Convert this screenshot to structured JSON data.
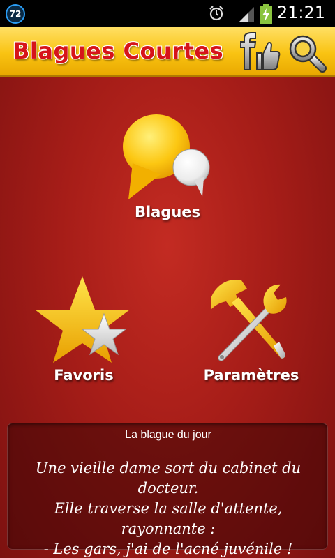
{
  "status_bar": {
    "notification_count": "72",
    "time": "21:21",
    "icons": [
      "alarm-icon",
      "signal-icon",
      "battery-charging-icon"
    ]
  },
  "header": {
    "title": "Blagues Courtes",
    "title_color": "#d6141a",
    "background_color": "#f9c312",
    "icons": [
      "facebook-like-icon",
      "search-icon"
    ]
  },
  "menu": {
    "blagues_label": "Blagues",
    "favoris_label": "Favoris",
    "parametres_label": "Paramètres",
    "icons": [
      "speech-bubbles-icon",
      "stars-icon",
      "tools-icon"
    ]
  },
  "joke_of_the_day": {
    "title": "La blague du jour",
    "lines": [
      "Une vieille dame sort du cabinet du docteur.",
      "Elle traverse la salle d'attente, rayonnante :",
      "- Les gars, j'ai de l'acné juvénile !"
    ]
  },
  "colors": {
    "background_red": "#a61d18",
    "accent_yellow": "#f9c312"
  }
}
